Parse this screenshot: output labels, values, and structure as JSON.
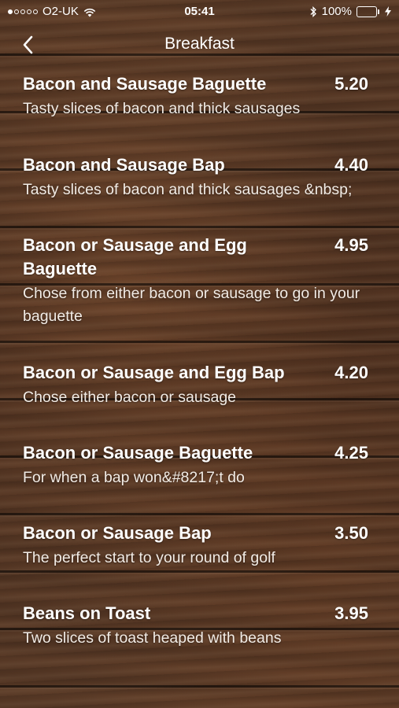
{
  "status_bar": {
    "carrier": "O2-UK",
    "time": "05:41",
    "battery_percent": "100%",
    "signal_bars_filled": 1,
    "signal_bars_total": 5,
    "battery_color": "#4cd964",
    "icons": [
      "wifi-icon",
      "bluetooth-icon",
      "battery-icon",
      "charging-icon"
    ]
  },
  "nav": {
    "title": "Breakfast",
    "back_icon": "chevron-left-icon"
  },
  "menu": {
    "items": [
      {
        "name": "Bacon and Sausage Baguette",
        "price": "5.20",
        "description": "Tasty slices of bacon and thick sausages"
      },
      {
        "name": "Bacon and Sausage Bap",
        "price": "4.40",
        "description": "Tasty slices of bacon and thick sausages &nbsp;"
      },
      {
        "name": "Bacon or Sausage and Egg Baguette",
        "price": "4.95",
        "description": "Chose from either bacon or sausage to go in your baguette"
      },
      {
        "name": "Bacon or Sausage and Egg Bap",
        "price": "4.20",
        "description": "Chose either bacon or sausage"
      },
      {
        "name": "Bacon or Sausage Baguette",
        "price": "4.25",
        "description": "For when a bap won&#8217;t do"
      },
      {
        "name": "Bacon or Sausage Bap",
        "price": "3.50",
        "description": "The perfect start to your round of golf"
      },
      {
        "name": "Beans on Toast",
        "price": "3.95",
        "description": "Two slices of toast heaped with beans"
      }
    ]
  }
}
